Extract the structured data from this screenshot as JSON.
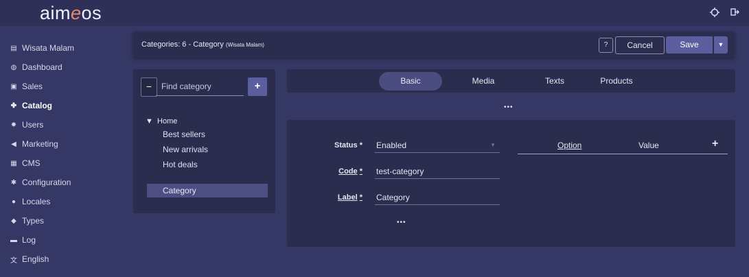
{
  "app": {
    "logo_pre": "aim",
    "logo_e": "e",
    "logo_post": "os"
  },
  "topbar": {
    "theme_icon": "theme-toggle-icon",
    "logout_icon": "logout-icon"
  },
  "sidebar": {
    "items": [
      {
        "label": "Wisata Malam",
        "icon": "site-icon",
        "glyph": "▤"
      },
      {
        "label": "Dashboard",
        "icon": "dashboard-icon",
        "glyph": "◍"
      },
      {
        "label": "Sales",
        "icon": "sales-icon",
        "glyph": "▣"
      },
      {
        "label": "Catalog",
        "icon": "catalog-icon",
        "glyph": "✤"
      },
      {
        "label": "Users",
        "icon": "users-icon",
        "glyph": "✸"
      },
      {
        "label": "Marketing",
        "icon": "marketing-icon",
        "glyph": "◀"
      },
      {
        "label": "CMS",
        "icon": "cms-icon",
        "glyph": "▦"
      },
      {
        "label": "Configuration",
        "icon": "configuration-icon",
        "glyph": "✱"
      },
      {
        "label": "Locales",
        "icon": "locales-icon",
        "glyph": "●"
      },
      {
        "label": "Types",
        "icon": "types-icon",
        "glyph": "◆"
      },
      {
        "label": "Log",
        "icon": "log-icon",
        "glyph": "▬"
      },
      {
        "label": "English",
        "icon": "language-icon",
        "glyph": "文"
      }
    ],
    "active": "Catalog"
  },
  "header": {
    "title": "Categories: 6 - Category",
    "site": "(Wisata Malam)",
    "help_label": "?",
    "cancel_label": "Cancel",
    "save_label": "Save"
  },
  "tree": {
    "search_placeholder": "Find category",
    "root": "Home",
    "children": [
      "Best sellers",
      "New arrivals",
      "Hot deals"
    ],
    "selected": "Category"
  },
  "tabs": [
    {
      "label": "Basic",
      "active": true
    },
    {
      "label": "Media",
      "active": false
    },
    {
      "label": "Texts",
      "active": false
    },
    {
      "label": "Products",
      "active": false
    }
  ],
  "more_label": "•••",
  "form": {
    "status": {
      "label": "Status",
      "marker": "*",
      "value": "Enabled"
    },
    "code": {
      "label": "Code",
      "marker": "*",
      "value": "test-category"
    },
    "label": {
      "label": "Label",
      "marker": "*",
      "value": "Category"
    },
    "options": {
      "option_header": "Option",
      "value_header": "Value",
      "add": "+"
    },
    "more_label": "•••"
  },
  "colors": {
    "background": "#353764",
    "panel": "#2b2d4f",
    "accent": "#5b5e9e",
    "logo_accent": "#e38b6f"
  }
}
